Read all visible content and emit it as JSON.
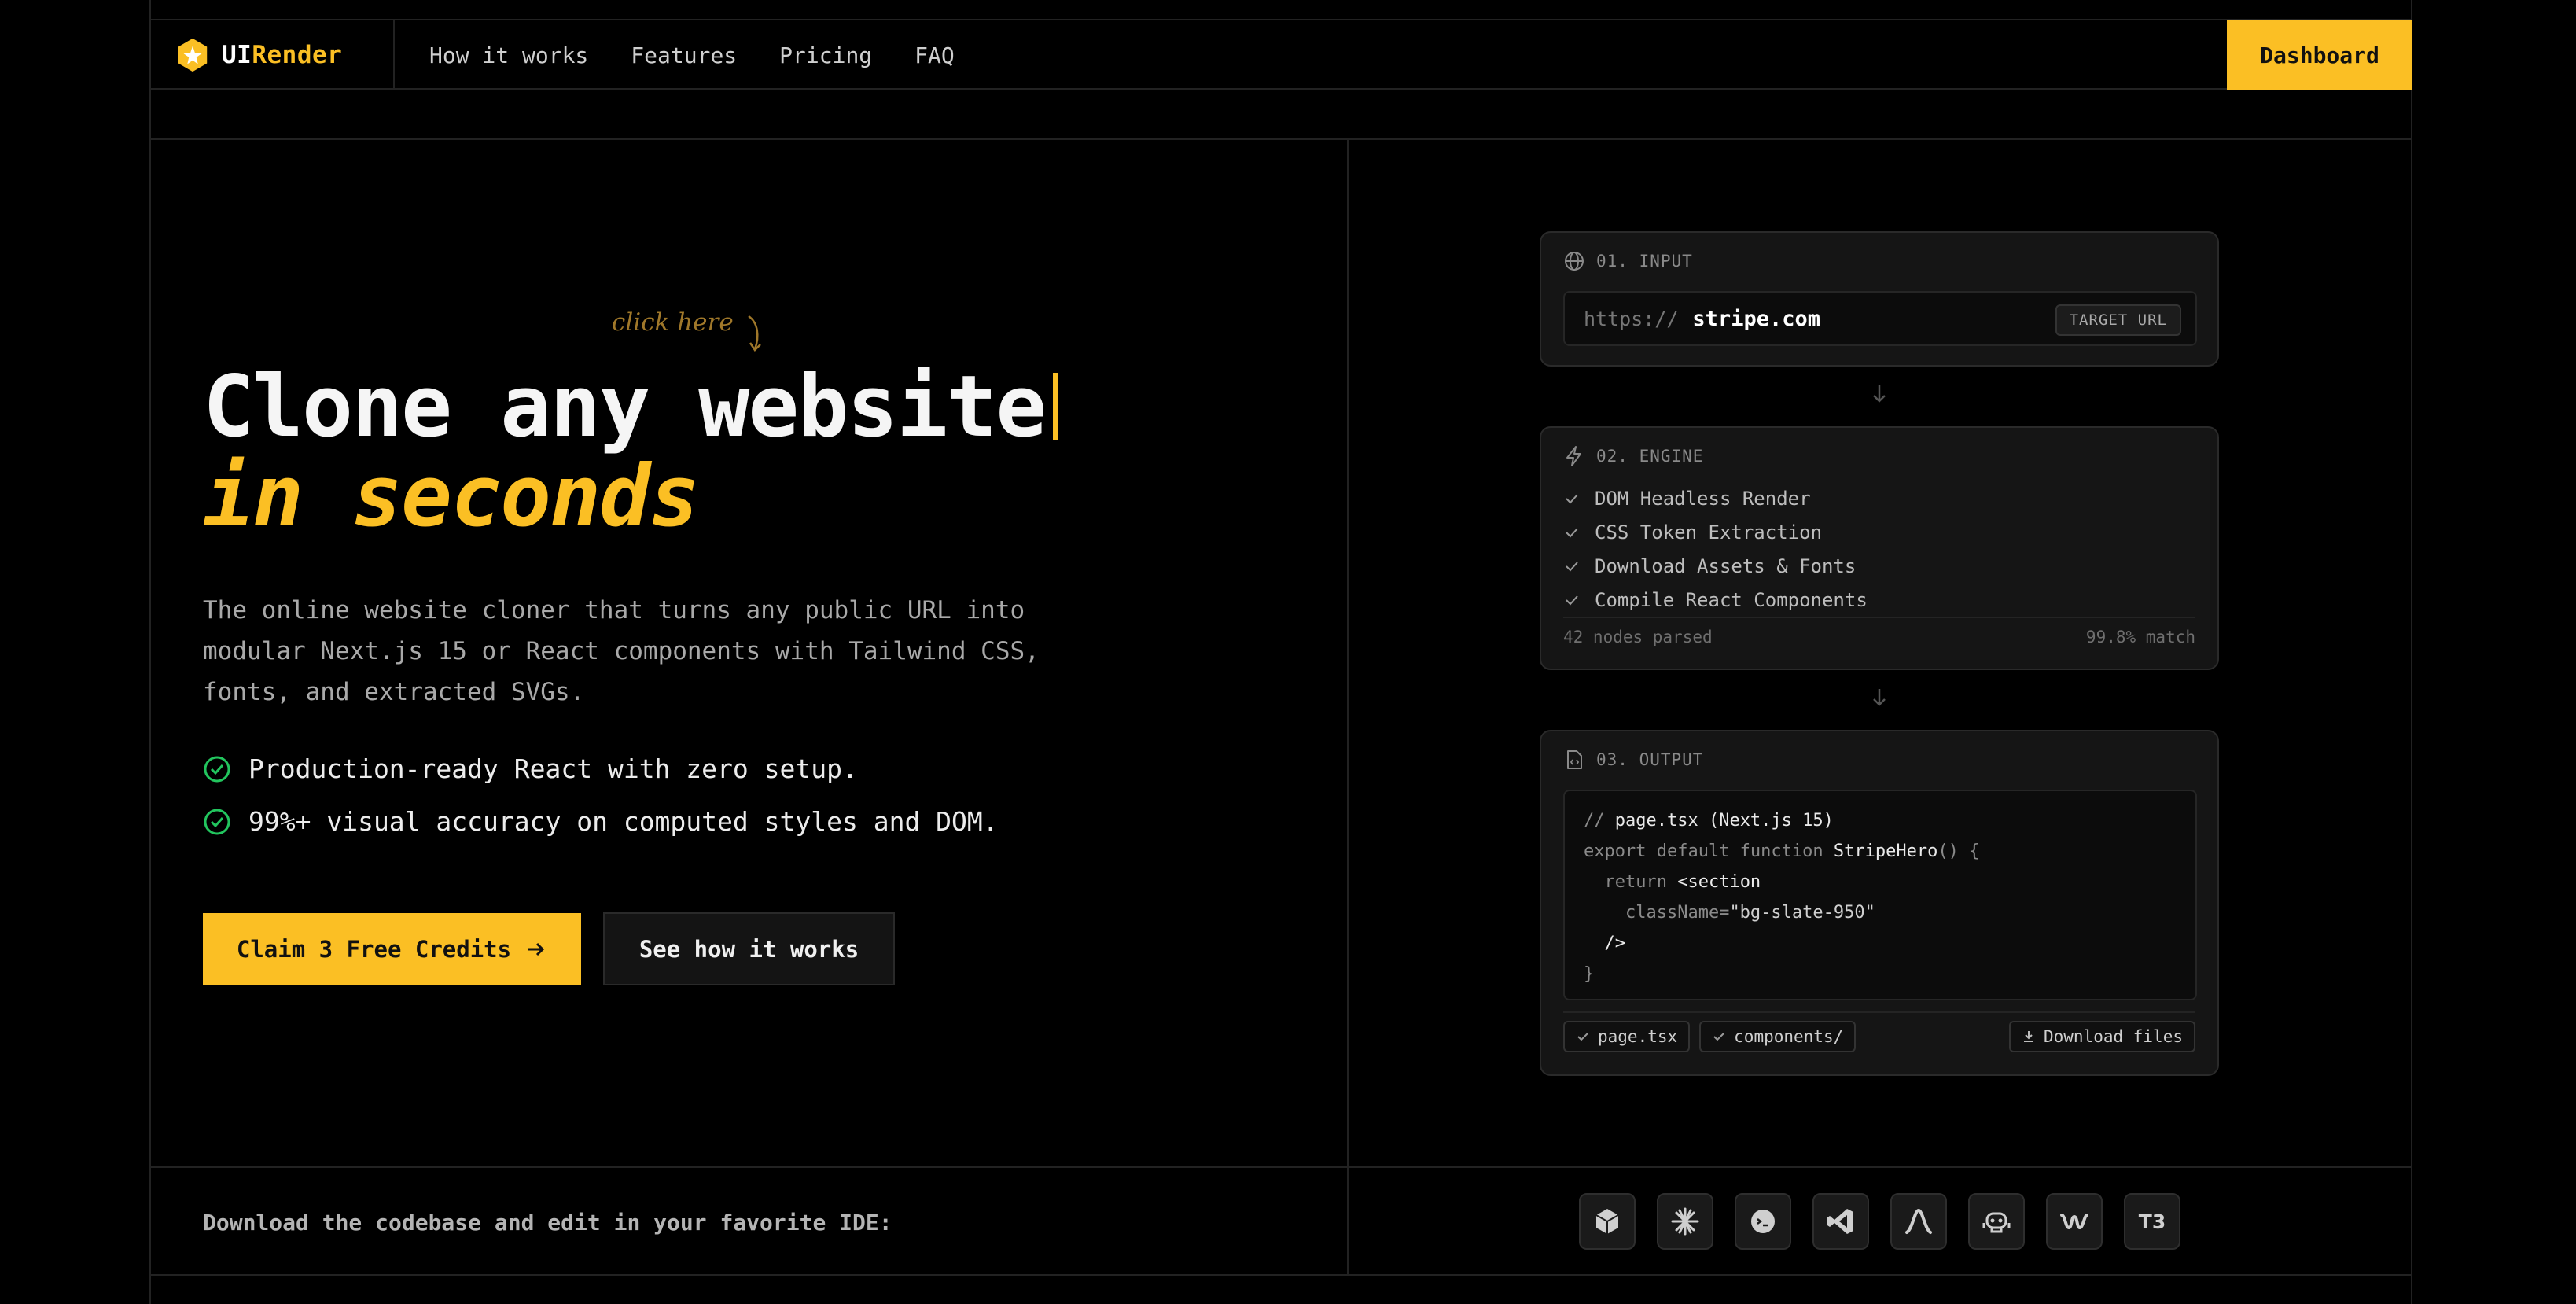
{
  "brand": {
    "name_a": "UI",
    "name_b": "Render"
  },
  "nav": {
    "links": [
      "How it works",
      "Features",
      "Pricing",
      "FAQ"
    ],
    "dashboard": "Dashboard"
  },
  "hero": {
    "note": "click here",
    "title": "Clone any website",
    "title_accent": "in seconds",
    "description": "The online website cloner that turns any public URL into modular Next.js 15 or React components with Tailwind CSS, fonts, and extracted SVGs.",
    "features": [
      "Production-ready React with zero setup.",
      "99%+ visual accuracy on computed styles and DOM."
    ],
    "cta_primary": "Claim 3 Free Credits",
    "cta_secondary": "See how it works"
  },
  "input_card": {
    "title": "01. INPUT",
    "protocol": "https://",
    "url": "stripe.com",
    "tag": "TARGET URL"
  },
  "engine_card": {
    "title": "02. ENGINE",
    "steps": [
      "DOM Headless Render",
      "CSS Token Extraction",
      "Download Assets & Fonts",
      "Compile React Components"
    ],
    "nodes": "42 nodes parsed",
    "match": "99.8% match"
  },
  "output_card": {
    "title": "03. OUTPUT",
    "code": {
      "l1a": "// ",
      "l1b": "page.tsx (Next.js 15)",
      "l2a": "export default function ",
      "l2b": "StripeHero",
      "l2c": "() {",
      "l3a": "  return ",
      "l3b": "<section",
      "l4a": "    className=",
      "l4b": "\"bg-slate-950\"",
      "l5": "  />",
      "l6": "}"
    },
    "chips": [
      "page.tsx",
      "components/"
    ],
    "download": "Download files"
  },
  "ide": {
    "label": "Download the codebase and edit in your favorite IDE:",
    "icons": [
      "cube-icon",
      "sparkle-icon",
      "face-icon",
      "vscode-icon",
      "arrow-a-icon",
      "copilot-icon",
      "windsurf-icon",
      "t3-icon"
    ],
    "t3_text": "T3"
  },
  "colors": {
    "accent": "#fbbf24",
    "success": "#22c55e",
    "background": "#000000"
  }
}
